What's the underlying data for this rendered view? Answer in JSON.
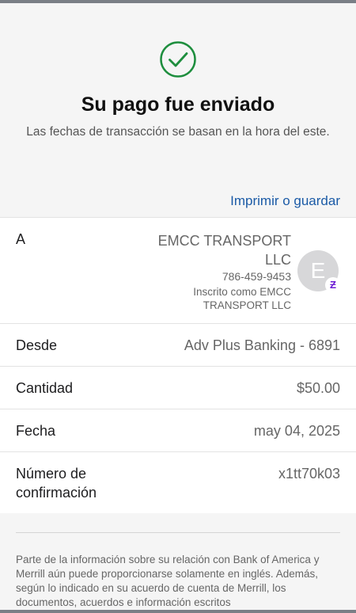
{
  "header": {
    "title": "Su pago fue enviado",
    "subtitle": "Las fechas de transacción se basan en la hora del este.",
    "icon": "checkmark-circle-icon",
    "accent_color": "#1e8e3e"
  },
  "actions": {
    "print_label": "Imprimir o guardar"
  },
  "details": {
    "to": {
      "label": "A",
      "name": "EMCC TRANSPORT LLC",
      "phone": "786-459-9453",
      "enrolled": "Inscrito como EMCC TRANSPORT LLC",
      "avatar_initial": "E",
      "badge_icon": "zelle-icon",
      "badge_glyph": "Ƶ"
    },
    "from": {
      "label": "Desde",
      "value": "Adv Plus Banking - 6891"
    },
    "amount": {
      "label": "Cantidad",
      "value": "$50.00"
    },
    "date": {
      "label": "Fecha",
      "value": "may 04, 2025"
    },
    "confirmation": {
      "label": "Número de confirmación",
      "value": "x1tt70k03"
    }
  },
  "footer": {
    "disclaimer": "Parte de la información sobre su relación con Bank of America y Merrill aún puede proporcionarse solamente en inglés. Además, según lo indicado en su acuerdo de cuenta de Merrill, los documentos, acuerdos e información escritos"
  }
}
